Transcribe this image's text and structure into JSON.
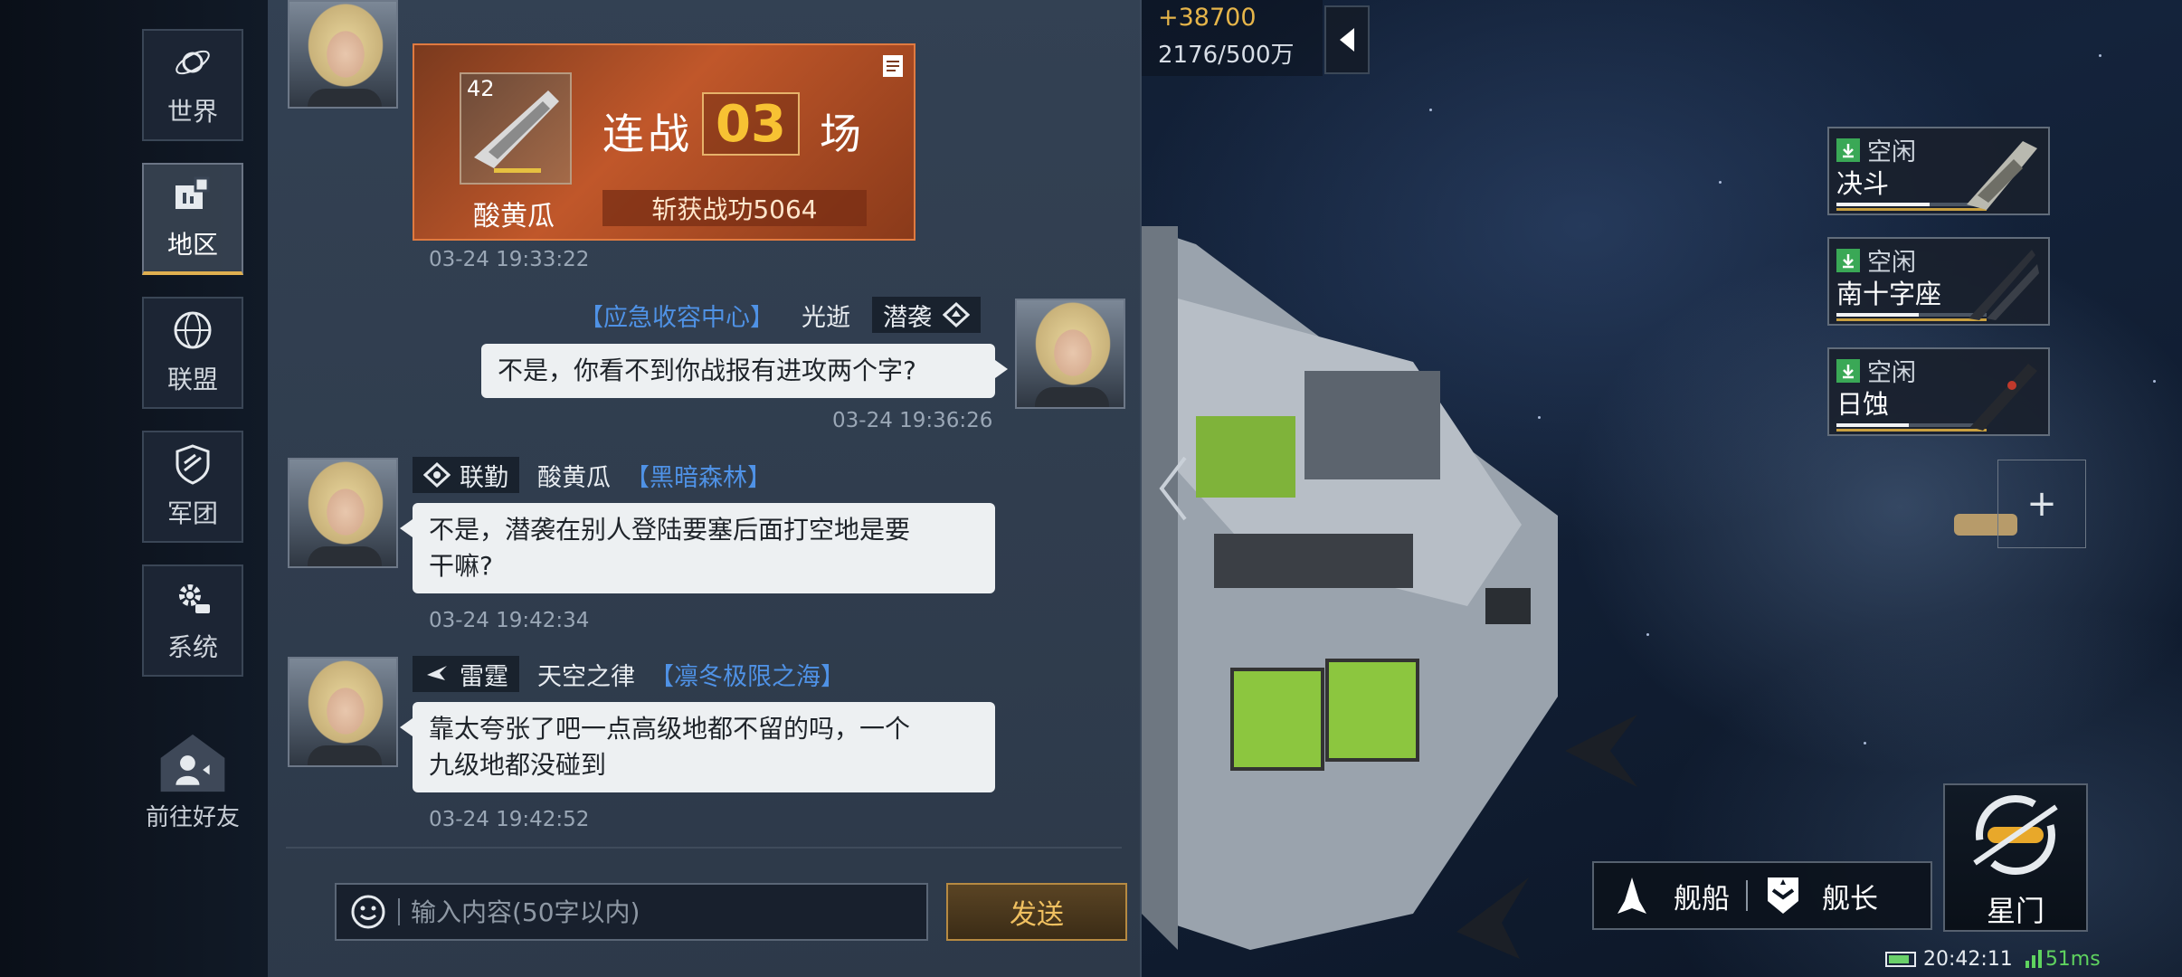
{
  "nav": {
    "items": [
      {
        "label": "世界"
      },
      {
        "label": "地区"
      },
      {
        "label": "联盟"
      },
      {
        "label": "军团"
      },
      {
        "label": "系统"
      }
    ],
    "friends_label": "前往好友"
  },
  "battle_card": {
    "level": "42",
    "player": "酸黄瓜",
    "streak_prefix": "连战",
    "streak_count": "03",
    "streak_suffix": "场",
    "reward": "斩获战功5064",
    "time": "03-24 19:33:22"
  },
  "messages": [
    {
      "guild": "【应急收容中心】",
      "name": "光逝",
      "tag": "潜袭",
      "text": "不是，你看不到你战报有进攻两个字?",
      "time": "03-24 19:36:26"
    },
    {
      "tag": "联勤",
      "name": "酸黄瓜",
      "guild": "【黑暗森林】",
      "text_lines": [
        "不是，潜袭在别人登陆要塞后面打空地是要",
        "干嘛?"
      ],
      "time": "03-24 19:42:34"
    },
    {
      "tag": "雷霆",
      "name": "天空之律",
      "guild": "【凛冬极限之海】",
      "text_lines": [
        "靠太夸张了吧一点高级地都不留的吗，一个",
        "九级地都没碰到"
      ],
      "time": "03-24 19:42:52"
    }
  ],
  "input": {
    "placeholder": "输入内容(50字以内)",
    "value": ""
  },
  "send_label": "发送",
  "resources": {
    "gain": "+38700",
    "amount": "2176/500万"
  },
  "fleets": [
    {
      "status": "空闲",
      "name": "决斗",
      "hp": 0.62
    },
    {
      "status": "空闲",
      "name": "南十字座",
      "hp": 0.55
    },
    {
      "status": "空闲",
      "name": "日蚀",
      "hp": 0.48
    }
  ],
  "add_label": "+",
  "bottom": {
    "ships_label": "舰船",
    "captain_label": "舰长",
    "stargate_label": "星门"
  },
  "status": {
    "time": "20:42:11",
    "ping": "51ms"
  }
}
